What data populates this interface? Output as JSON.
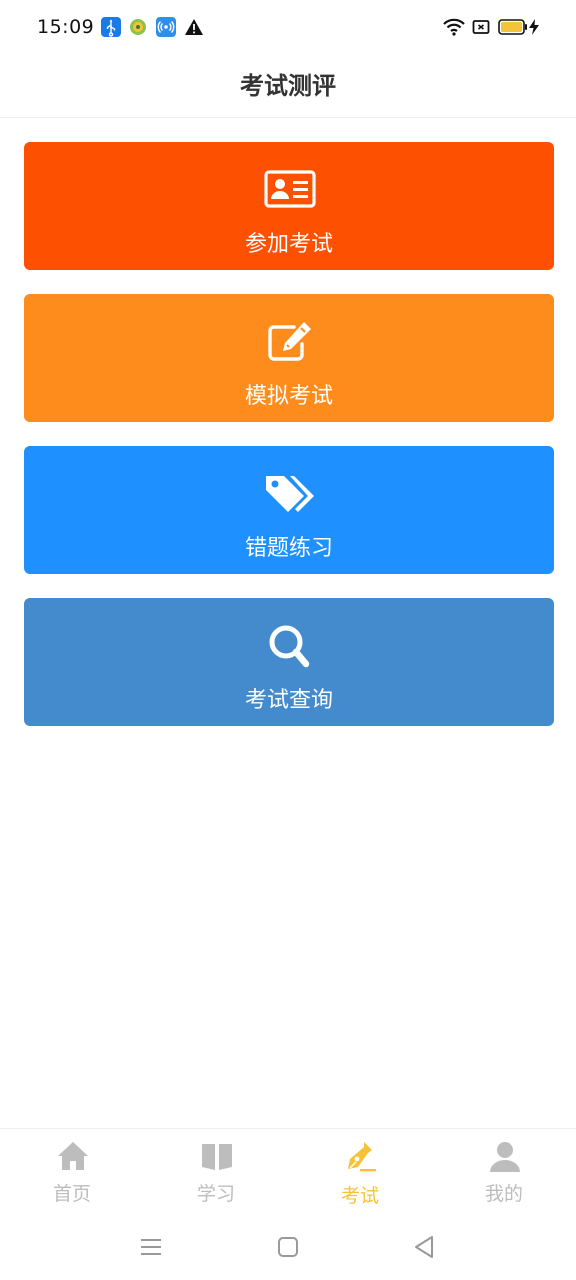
{
  "status_bar": {
    "time": "15:09",
    "left_icons": [
      "usb-icon",
      "app-notification-icon",
      "hotspot-icon",
      "warning-icon"
    ],
    "right_icons": [
      "wifi-icon",
      "screen-cast-icon",
      "battery-icon",
      "charging-icon"
    ],
    "battery_color": "#f5c339"
  },
  "header": {
    "title": "考试测评"
  },
  "cards": [
    {
      "label": "参加考试",
      "icon": "id-card-icon",
      "color": "#fd5000"
    },
    {
      "label": "模拟考试",
      "icon": "edit-icon",
      "color": "#fd8c1c"
    },
    {
      "label": "错题练习",
      "icon": "tags-icon",
      "color": "#1e90ff"
    },
    {
      "label": "考试查询",
      "icon": "search-icon",
      "color": "#438bcc"
    }
  ],
  "tab_bar": {
    "active_color": "#f5c339",
    "inactive_color": "#bdbdbd",
    "items": [
      {
        "label": "首页",
        "icon": "home-icon",
        "active": false
      },
      {
        "label": "学习",
        "icon": "book-icon",
        "active": false
      },
      {
        "label": "考试",
        "icon": "pen-nib-icon",
        "active": true
      },
      {
        "label": "我的",
        "icon": "user-icon",
        "active": false
      }
    ]
  },
  "system_nav": {
    "buttons": [
      "menu-icon",
      "home-square-icon",
      "back-triangle-icon"
    ]
  }
}
